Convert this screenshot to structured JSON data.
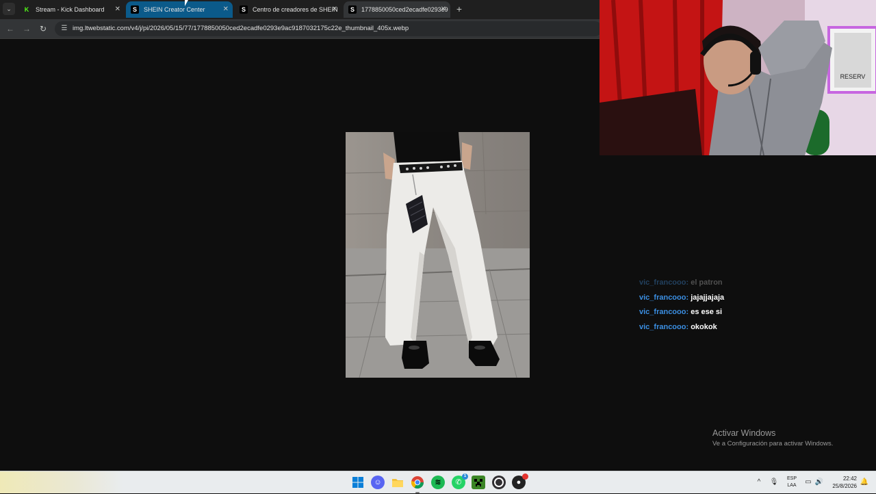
{
  "browser": {
    "tabs": [
      {
        "title": "Stream - Kick Dashboard",
        "favicon": "kick-icon"
      },
      {
        "title": "SHEIN Creator Center",
        "favicon": "shein-icon"
      },
      {
        "title": "Centro de creadores de SHEIN",
        "favicon": "shein-icon"
      },
      {
        "title": "1778850050ced2ecadfe0293e9",
        "favicon": "shein-icon"
      }
    ],
    "active_tab_index": 3,
    "url": "img.ltwebstatic.com/v4/j/pi/2026/05/15/77/1778850050ced2ecadfe0293e9ac9187032175c22e_thumbnail_405x.webp",
    "accent_color": "#0b5a8a"
  },
  "chat": {
    "messages": [
      {
        "user": "vic_francooo:",
        "text": "el patron",
        "faded": true
      },
      {
        "user": "vic_francooo:",
        "text": "jajajjajaja",
        "faded": false
      },
      {
        "user": "vic_francooo:",
        "text": "es ese si",
        "faded": false
      },
      {
        "user": "vic_francooo:",
        "text": "okokok",
        "faded": false
      }
    ],
    "username_color": "#3b8fe3"
  },
  "activation": {
    "title": "Activar Windows",
    "subtitle": "Ve a Configuración para activar Windows."
  },
  "taskbar": {
    "apps": [
      {
        "name": "windows-start-icon"
      },
      {
        "name": "discord-icon"
      },
      {
        "name": "file-explorer-icon"
      },
      {
        "name": "chrome-icon",
        "active": true
      },
      {
        "name": "spotify-icon"
      },
      {
        "name": "whatsapp-icon",
        "badge": "1"
      },
      {
        "name": "minecraft-icon"
      },
      {
        "name": "obs-icon"
      },
      {
        "name": "app-icon-red-badge"
      }
    ],
    "lang_top": "ESP",
    "lang_bottom": "LAA",
    "time": "22:42",
    "date": "25/8/2026"
  }
}
